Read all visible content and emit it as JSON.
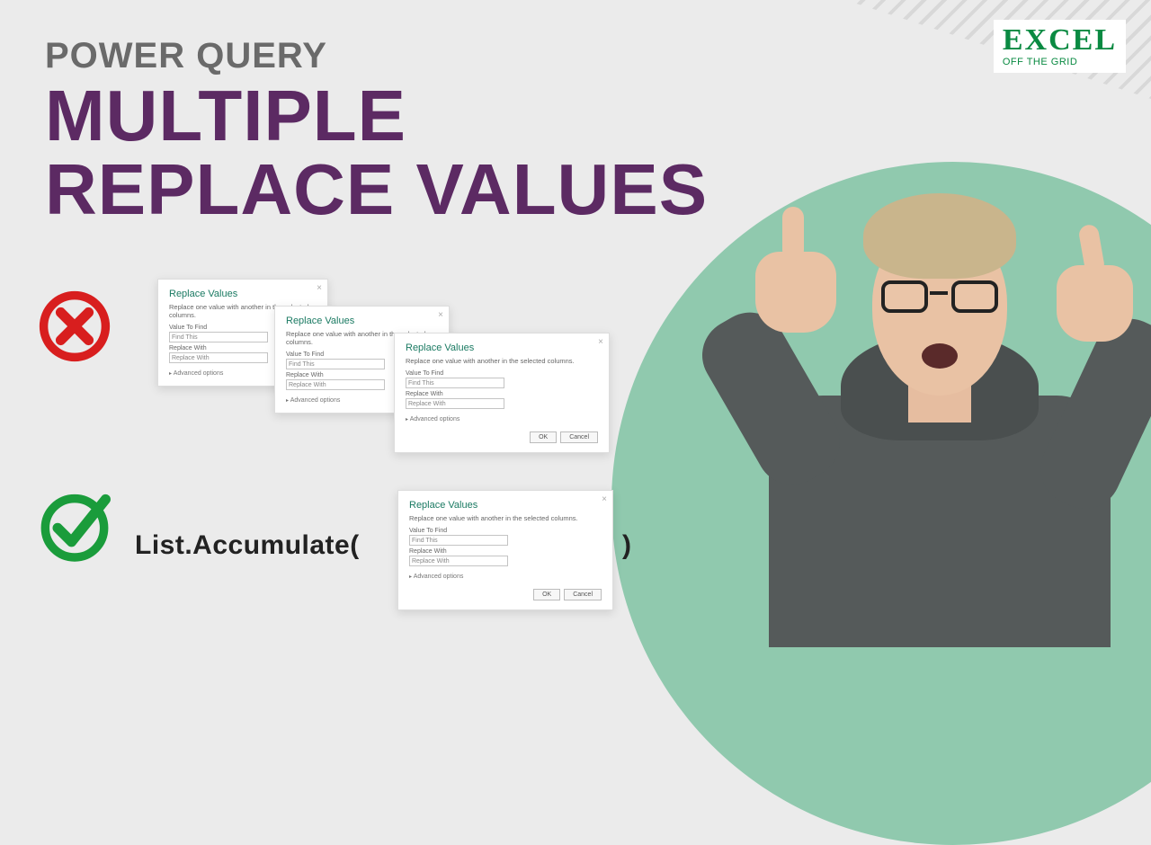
{
  "logo": {
    "line1": "EXCEL",
    "line2": "OFF THE GRID"
  },
  "title": {
    "eyebrow": "POWER QUERY",
    "line1": "MULTIPLE",
    "line2": "REPLACE VALUES"
  },
  "icons": {
    "cross": "cross-circle",
    "check": "check-circle"
  },
  "dialog": {
    "title": "Replace Values",
    "subtitle": "Replace one value with another in the selected columns.",
    "label_find": "Value To Find",
    "input_find": "Find This",
    "label_replace": "Replace With",
    "input_replace": "Replace With",
    "advanced": "Advanced options",
    "btn_ok": "OK",
    "btn_cancel": "Cancel",
    "close": "×"
  },
  "function": {
    "open": "List.Accumulate(",
    "close": ")"
  }
}
